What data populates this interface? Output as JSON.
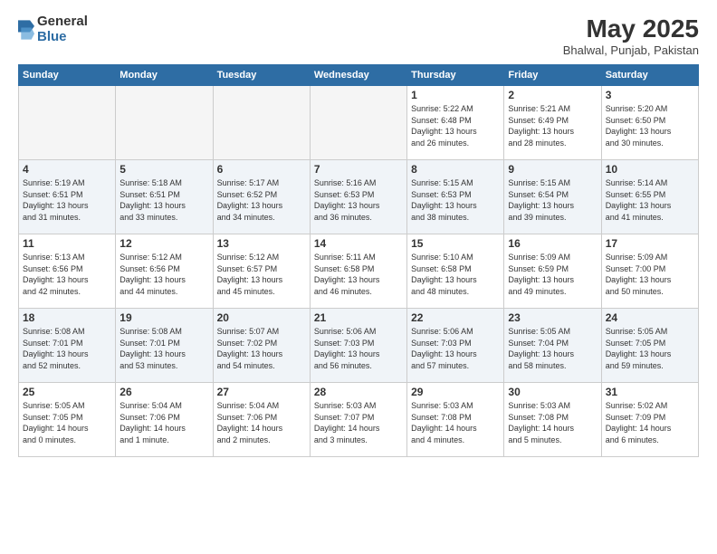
{
  "logo": {
    "general": "General",
    "blue": "Blue"
  },
  "title": {
    "month_year": "May 2025",
    "location": "Bhalwal, Punjab, Pakistan"
  },
  "days_of_week": [
    "Sunday",
    "Monday",
    "Tuesday",
    "Wednesday",
    "Thursday",
    "Friday",
    "Saturday"
  ],
  "weeks": [
    [
      {
        "day": "",
        "info": ""
      },
      {
        "day": "",
        "info": ""
      },
      {
        "day": "",
        "info": ""
      },
      {
        "day": "",
        "info": ""
      },
      {
        "day": "1",
        "info": "Sunrise: 5:22 AM\nSunset: 6:48 PM\nDaylight: 13 hours\nand 26 minutes."
      },
      {
        "day": "2",
        "info": "Sunrise: 5:21 AM\nSunset: 6:49 PM\nDaylight: 13 hours\nand 28 minutes."
      },
      {
        "day": "3",
        "info": "Sunrise: 5:20 AM\nSunset: 6:50 PM\nDaylight: 13 hours\nand 30 minutes."
      }
    ],
    [
      {
        "day": "4",
        "info": "Sunrise: 5:19 AM\nSunset: 6:51 PM\nDaylight: 13 hours\nand 31 minutes."
      },
      {
        "day": "5",
        "info": "Sunrise: 5:18 AM\nSunset: 6:51 PM\nDaylight: 13 hours\nand 33 minutes."
      },
      {
        "day": "6",
        "info": "Sunrise: 5:17 AM\nSunset: 6:52 PM\nDaylight: 13 hours\nand 34 minutes."
      },
      {
        "day": "7",
        "info": "Sunrise: 5:16 AM\nSunset: 6:53 PM\nDaylight: 13 hours\nand 36 minutes."
      },
      {
        "day": "8",
        "info": "Sunrise: 5:15 AM\nSunset: 6:53 PM\nDaylight: 13 hours\nand 38 minutes."
      },
      {
        "day": "9",
        "info": "Sunrise: 5:15 AM\nSunset: 6:54 PM\nDaylight: 13 hours\nand 39 minutes."
      },
      {
        "day": "10",
        "info": "Sunrise: 5:14 AM\nSunset: 6:55 PM\nDaylight: 13 hours\nand 41 minutes."
      }
    ],
    [
      {
        "day": "11",
        "info": "Sunrise: 5:13 AM\nSunset: 6:56 PM\nDaylight: 13 hours\nand 42 minutes."
      },
      {
        "day": "12",
        "info": "Sunrise: 5:12 AM\nSunset: 6:56 PM\nDaylight: 13 hours\nand 44 minutes."
      },
      {
        "day": "13",
        "info": "Sunrise: 5:12 AM\nSunset: 6:57 PM\nDaylight: 13 hours\nand 45 minutes."
      },
      {
        "day": "14",
        "info": "Sunrise: 5:11 AM\nSunset: 6:58 PM\nDaylight: 13 hours\nand 46 minutes."
      },
      {
        "day": "15",
        "info": "Sunrise: 5:10 AM\nSunset: 6:58 PM\nDaylight: 13 hours\nand 48 minutes."
      },
      {
        "day": "16",
        "info": "Sunrise: 5:09 AM\nSunset: 6:59 PM\nDaylight: 13 hours\nand 49 minutes."
      },
      {
        "day": "17",
        "info": "Sunrise: 5:09 AM\nSunset: 7:00 PM\nDaylight: 13 hours\nand 50 minutes."
      }
    ],
    [
      {
        "day": "18",
        "info": "Sunrise: 5:08 AM\nSunset: 7:01 PM\nDaylight: 13 hours\nand 52 minutes."
      },
      {
        "day": "19",
        "info": "Sunrise: 5:08 AM\nSunset: 7:01 PM\nDaylight: 13 hours\nand 53 minutes."
      },
      {
        "day": "20",
        "info": "Sunrise: 5:07 AM\nSunset: 7:02 PM\nDaylight: 13 hours\nand 54 minutes."
      },
      {
        "day": "21",
        "info": "Sunrise: 5:06 AM\nSunset: 7:03 PM\nDaylight: 13 hours\nand 56 minutes."
      },
      {
        "day": "22",
        "info": "Sunrise: 5:06 AM\nSunset: 7:03 PM\nDaylight: 13 hours\nand 57 minutes."
      },
      {
        "day": "23",
        "info": "Sunrise: 5:05 AM\nSunset: 7:04 PM\nDaylight: 13 hours\nand 58 minutes."
      },
      {
        "day": "24",
        "info": "Sunrise: 5:05 AM\nSunset: 7:05 PM\nDaylight: 13 hours\nand 59 minutes."
      }
    ],
    [
      {
        "day": "25",
        "info": "Sunrise: 5:05 AM\nSunset: 7:05 PM\nDaylight: 14 hours\nand 0 minutes."
      },
      {
        "day": "26",
        "info": "Sunrise: 5:04 AM\nSunset: 7:06 PM\nDaylight: 14 hours\nand 1 minute."
      },
      {
        "day": "27",
        "info": "Sunrise: 5:04 AM\nSunset: 7:06 PM\nDaylight: 14 hours\nand 2 minutes."
      },
      {
        "day": "28",
        "info": "Sunrise: 5:03 AM\nSunset: 7:07 PM\nDaylight: 14 hours\nand 3 minutes."
      },
      {
        "day": "29",
        "info": "Sunrise: 5:03 AM\nSunset: 7:08 PM\nDaylight: 14 hours\nand 4 minutes."
      },
      {
        "day": "30",
        "info": "Sunrise: 5:03 AM\nSunset: 7:08 PM\nDaylight: 14 hours\nand 5 minutes."
      },
      {
        "day": "31",
        "info": "Sunrise: 5:02 AM\nSunset: 7:09 PM\nDaylight: 14 hours\nand 6 minutes."
      }
    ]
  ]
}
